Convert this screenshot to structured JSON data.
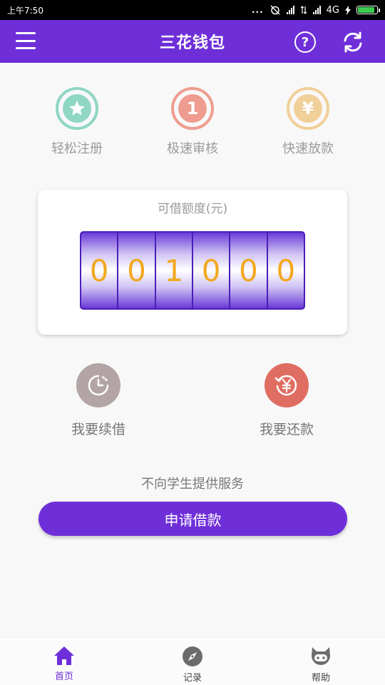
{
  "status_bar": {
    "time": "上午7:50",
    "network": "4G",
    "dots": "..."
  },
  "app_bar": {
    "title": "三花钱包"
  },
  "features": [
    {
      "label": "轻松注册",
      "icon": "star-icon",
      "color": "#8fd6c3"
    },
    {
      "label": "极速审核",
      "icon": "number-one-icon",
      "symbol": "1",
      "color": "#ee9c8f"
    },
    {
      "label": "快速放款",
      "icon": "yuan-icon",
      "symbol": "¥",
      "color": "#f1cf98"
    }
  ],
  "limit": {
    "title": "可借额度(元)",
    "digits": [
      "0",
      "0",
      "1",
      "0",
      "0",
      "0"
    ],
    "digit_color": "#f2a81e"
  },
  "actions": [
    {
      "label": "我要续借",
      "icon": "clock-icon",
      "color": "#b3a5a5"
    },
    {
      "label": "我要还款",
      "icon": "yuan-refund-icon",
      "color": "#e06d62"
    }
  ],
  "notice": "不向学生提供服务",
  "apply_button": "申请借款",
  "bottom_nav": [
    {
      "label": "首页",
      "icon": "home-icon",
      "active": true
    },
    {
      "label": "记录",
      "icon": "compass-icon",
      "active": false
    },
    {
      "label": "帮助",
      "icon": "cat-icon",
      "active": false
    }
  ],
  "colors": {
    "primary": "#6e2fd9"
  }
}
